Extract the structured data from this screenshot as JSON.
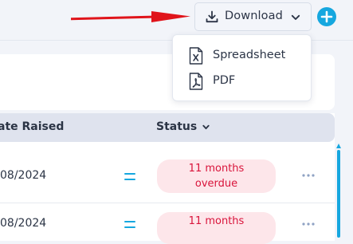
{
  "toolbar": {
    "download_label": "Download"
  },
  "download_menu": {
    "items": [
      {
        "label": "Spreadsheet",
        "icon": "spreadsheet-file-icon"
      },
      {
        "label": "PDF",
        "icon": "pdf-file-icon"
      }
    ]
  },
  "table": {
    "columns": {
      "date_raised": "ate Raised",
      "status": "Status"
    },
    "rows": [
      {
        "date": "08/2024",
        "status_line1": "11 months",
        "status_line2": "overdue"
      },
      {
        "date": "08/2024",
        "status_line1": "11 months",
        "status_line2": ""
      }
    ]
  },
  "colors": {
    "accent": "#16a7df",
    "overdue_text": "#d9143b",
    "overdue_bg": "#fde6ea",
    "annotation_arrow": "#e0141b"
  },
  "icons": {
    "download": "download-icon",
    "dropdown": "chevron-down-icon",
    "add": "plus-icon",
    "sort": "sort-chevron-icon",
    "priority": "priority-equals-icon",
    "row_menu": "more-horizontal-icon"
  }
}
